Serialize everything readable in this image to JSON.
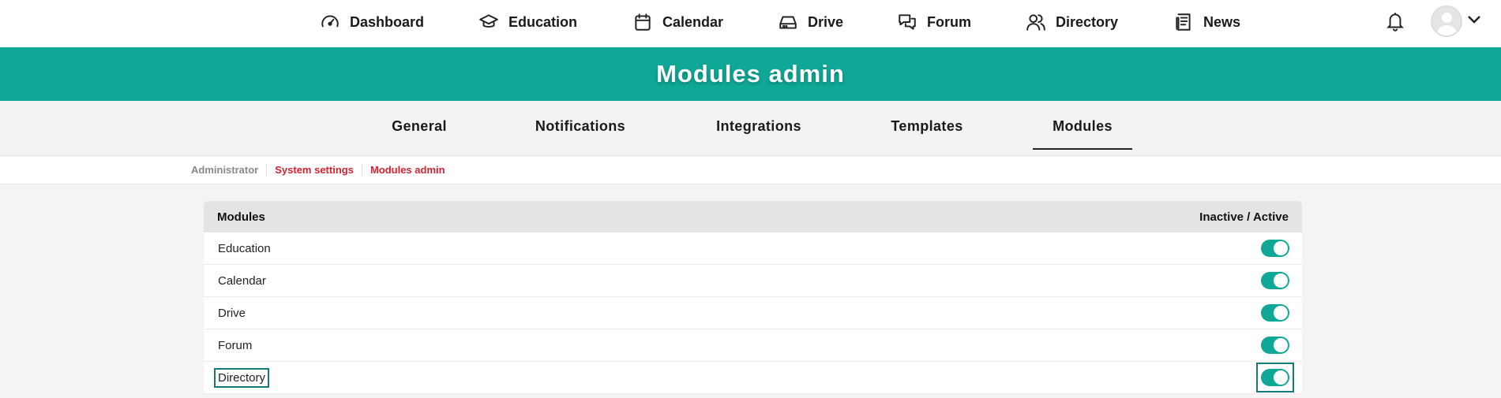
{
  "nav": {
    "items": [
      {
        "label": "Dashboard",
        "icon": "speedometer-icon"
      },
      {
        "label": "Education",
        "icon": "graduation-cap-icon"
      },
      {
        "label": "Calendar",
        "icon": "calendar-icon"
      },
      {
        "label": "Drive",
        "icon": "hard-drive-icon"
      },
      {
        "label": "Forum",
        "icon": "chat-bubbles-icon"
      },
      {
        "label": "Directory",
        "icon": "users-icon"
      },
      {
        "label": "News",
        "icon": "newspaper-icon"
      }
    ]
  },
  "banner": {
    "title": "Modules admin"
  },
  "tabs": [
    {
      "label": "General",
      "active": false
    },
    {
      "label": "Notifications",
      "active": false
    },
    {
      "label": "Integrations",
      "active": false
    },
    {
      "label": "Templates",
      "active": false
    },
    {
      "label": "Modules",
      "active": true
    }
  ],
  "breadcrumb": [
    "Administrator",
    "System settings",
    "Modules admin"
  ],
  "table": {
    "header_left": "Modules",
    "header_right": "Inactive / Active",
    "rows": [
      {
        "name": "Education",
        "active": true
      },
      {
        "name": "Calendar",
        "active": true
      },
      {
        "name": "Drive",
        "active": true
      },
      {
        "name": "Forum",
        "active": true
      },
      {
        "name": "Directory",
        "active": true,
        "focused": true
      }
    ]
  },
  "colors": {
    "accent": "#0fa896",
    "link": "#d6202f",
    "focus": "#137a75"
  }
}
